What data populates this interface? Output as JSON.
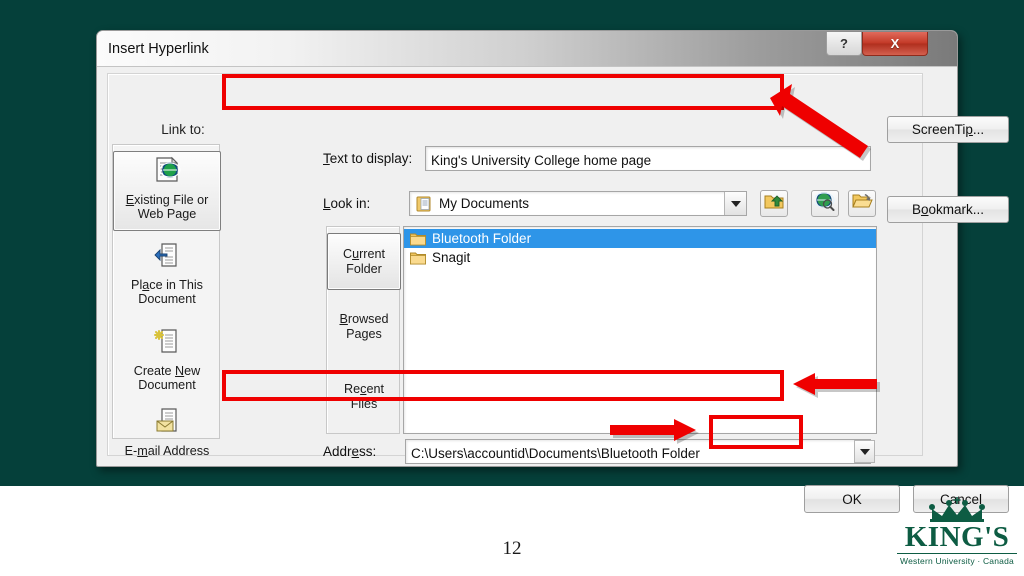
{
  "slide": {
    "page_number": "12",
    "background_color": "#05403a",
    "logo": {
      "wordmark": "KING'S",
      "tagline": "Western University · Canada",
      "color": "#0d5c43",
      "crown_icon": "crown-icon"
    }
  },
  "dialog": {
    "title": "Insert Hyperlink",
    "titlebar_buttons": [
      {
        "name": "help-button",
        "label": "?"
      },
      {
        "name": "close-button",
        "label": "X"
      }
    ],
    "link_to": {
      "label": "Link to:",
      "items": [
        {
          "label_line1": "Existing File or",
          "label_line2": "Web Page",
          "icon": "page-globe-icon",
          "selected": true
        },
        {
          "label_line1": "Place in This",
          "label_line2": "Document",
          "icon": "page-arrow-icon",
          "selected": false
        },
        {
          "label_line1": "Create New",
          "label_line2": "Document",
          "icon": "page-new-icon",
          "selected": false
        },
        {
          "label_line1": "E-mail Address",
          "label_line2": "",
          "icon": "page-envelope-icon",
          "selected": false
        }
      ]
    },
    "text_to_display": {
      "label": "Text to display:",
      "value": "King's University College home page",
      "placeholder": ""
    },
    "look_in": {
      "label": "Look in:",
      "value": "My Documents",
      "icon": "documents-folder-icon",
      "dropdown_icon": "chevron-down-icon"
    },
    "toolbar_buttons": [
      {
        "name": "up-one-level-button",
        "icon": "folder-up-icon"
      },
      {
        "name": "browse-web-button",
        "icon": "globe-search-icon"
      },
      {
        "name": "browse-file-button",
        "icon": "open-folder-icon"
      }
    ],
    "folder_tabs": [
      {
        "label_line1": "Current",
        "label_line2": "Folder",
        "selected": true
      },
      {
        "label_line1": "Browsed",
        "label_line2": "Pages",
        "selected": false
      },
      {
        "label_line1": "Recent",
        "label_line2": "Files",
        "selected": false
      }
    ],
    "file_list": [
      {
        "name": "Bluetooth Folder",
        "icon": "folder-icon",
        "selected": true
      },
      {
        "name": "Snagit",
        "icon": "folder-icon",
        "selected": false
      }
    ],
    "address": {
      "label": "Address:",
      "value": "C:\\Users\\accountid\\Documents\\Bluetooth Folder",
      "dropdown_icon": "chevron-down-icon"
    },
    "side_buttons": [
      {
        "name": "screentip-button",
        "label": "ScreenTip..."
      },
      {
        "name": "bookmark-button",
        "label": "Bookmark..."
      }
    ],
    "ok_button": "OK",
    "cancel_button": "Cancel"
  },
  "annotations": {
    "highlight_color": "#ef0000",
    "arrow_color": "#ef0000",
    "highlights": [
      {
        "name": "highlight-text-to-display"
      },
      {
        "name": "highlight-address"
      },
      {
        "name": "highlight-ok-button"
      }
    ],
    "arrows": [
      {
        "name": "arrow-to-text-to-display",
        "direction": "up-left"
      },
      {
        "name": "arrow-to-address",
        "direction": "left"
      },
      {
        "name": "arrow-to-ok-button",
        "direction": "right"
      }
    ]
  }
}
